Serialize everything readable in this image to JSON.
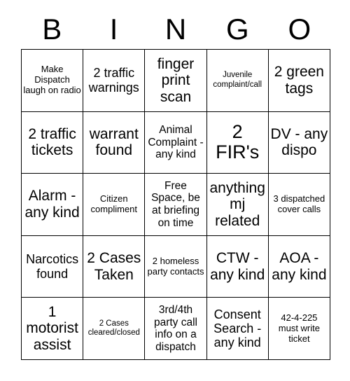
{
  "card": {
    "header_letters": [
      "B",
      "I",
      "N",
      "G",
      "O"
    ],
    "background_color": "#ffffff",
    "line_color": "#000000",
    "text_color": "#000000",
    "rows": [
      [
        "Make Dispatch laugh on radio",
        "2 traffic warnings",
        "finger print scan",
        "Juvenile complaint/call",
        "2 green tags"
      ],
      [
        "2 traffic tickets",
        "warrant found",
        "Animal Complaint - any kind",
        "2 FIR's",
        "DV - any dispo"
      ],
      [
        "Alarm - any kind",
        "Citizen compliment",
        "Free Space, be at briefing on time",
        "anything mj related",
        "3 dispatched cover calls"
      ],
      [
        "Narcotics found",
        "2 Cases Taken",
        "2 homeless party contacts",
        "CTW - any kind",
        "AOA - any kind"
      ],
      [
        "1 motorist assist",
        "2 Cases cleared/closed",
        "3rd/4th party call info on a dispatch",
        "Consent Search - any kind",
        "42-4-225 must write ticket"
      ]
    ],
    "size_classes": [
      [
        "fs-s",
        "fs-l",
        "fs-xl",
        "fs-xs",
        "fs-xl"
      ],
      [
        "fs-xl",
        "fs-xl",
        "fs-m",
        "fs-xxl",
        "fs-xl"
      ],
      [
        "fs-xl",
        "fs-s",
        "fs-m",
        "fs-xl",
        "fs-s"
      ],
      [
        "fs-l",
        "fs-xl",
        "fs-s",
        "fs-xl",
        "fs-xl"
      ],
      [
        "fs-xl",
        "fs-xs",
        "fs-m",
        "fs-l",
        "fs-s"
      ]
    ]
  }
}
